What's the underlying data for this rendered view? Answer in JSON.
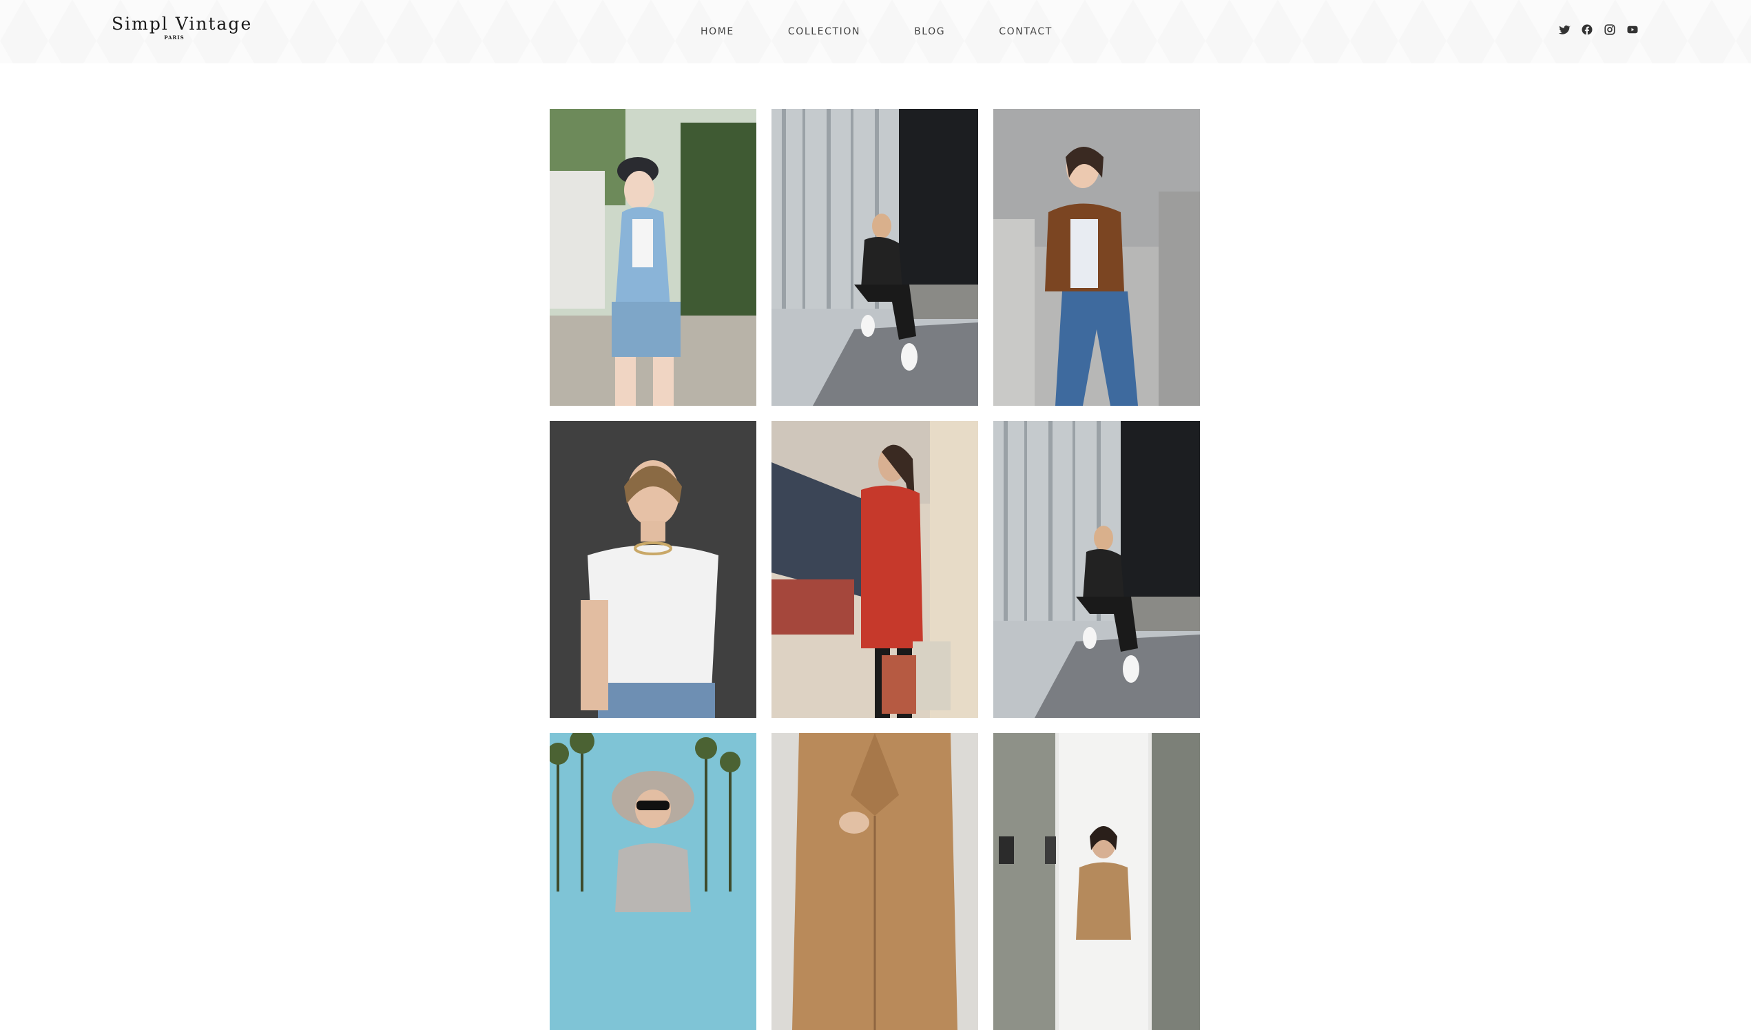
{
  "brand": {
    "title": "Simpl Vintage",
    "subtitle": "PARIS"
  },
  "nav": {
    "items": [
      {
        "label": "HOME"
      },
      {
        "label": "COLLECTION"
      },
      {
        "label": "BLOG"
      },
      {
        "label": "CONTACT"
      }
    ]
  },
  "social": {
    "icons": [
      "twitter-icon",
      "facebook-icon",
      "instagram-icon",
      "youtube-icon"
    ],
    "color": "#333333"
  },
  "gallery": {
    "photos": [
      {
        "subject": "woman-denim-jacket-cap"
      },
      {
        "subject": "woman-sitting-metal-wall"
      },
      {
        "subject": "woman-brown-leather-jacket"
      },
      {
        "subject": "woman-white-tee-portrait"
      },
      {
        "subject": "woman-red-coat-shopping-bag"
      },
      {
        "subject": "woman-sitting-metal-wall"
      },
      {
        "subject": "woman-sun-hat-palm-trees"
      },
      {
        "subject": "camel-blazer-closeup"
      },
      {
        "subject": "woman-doorway-camel-coat"
      }
    ]
  }
}
